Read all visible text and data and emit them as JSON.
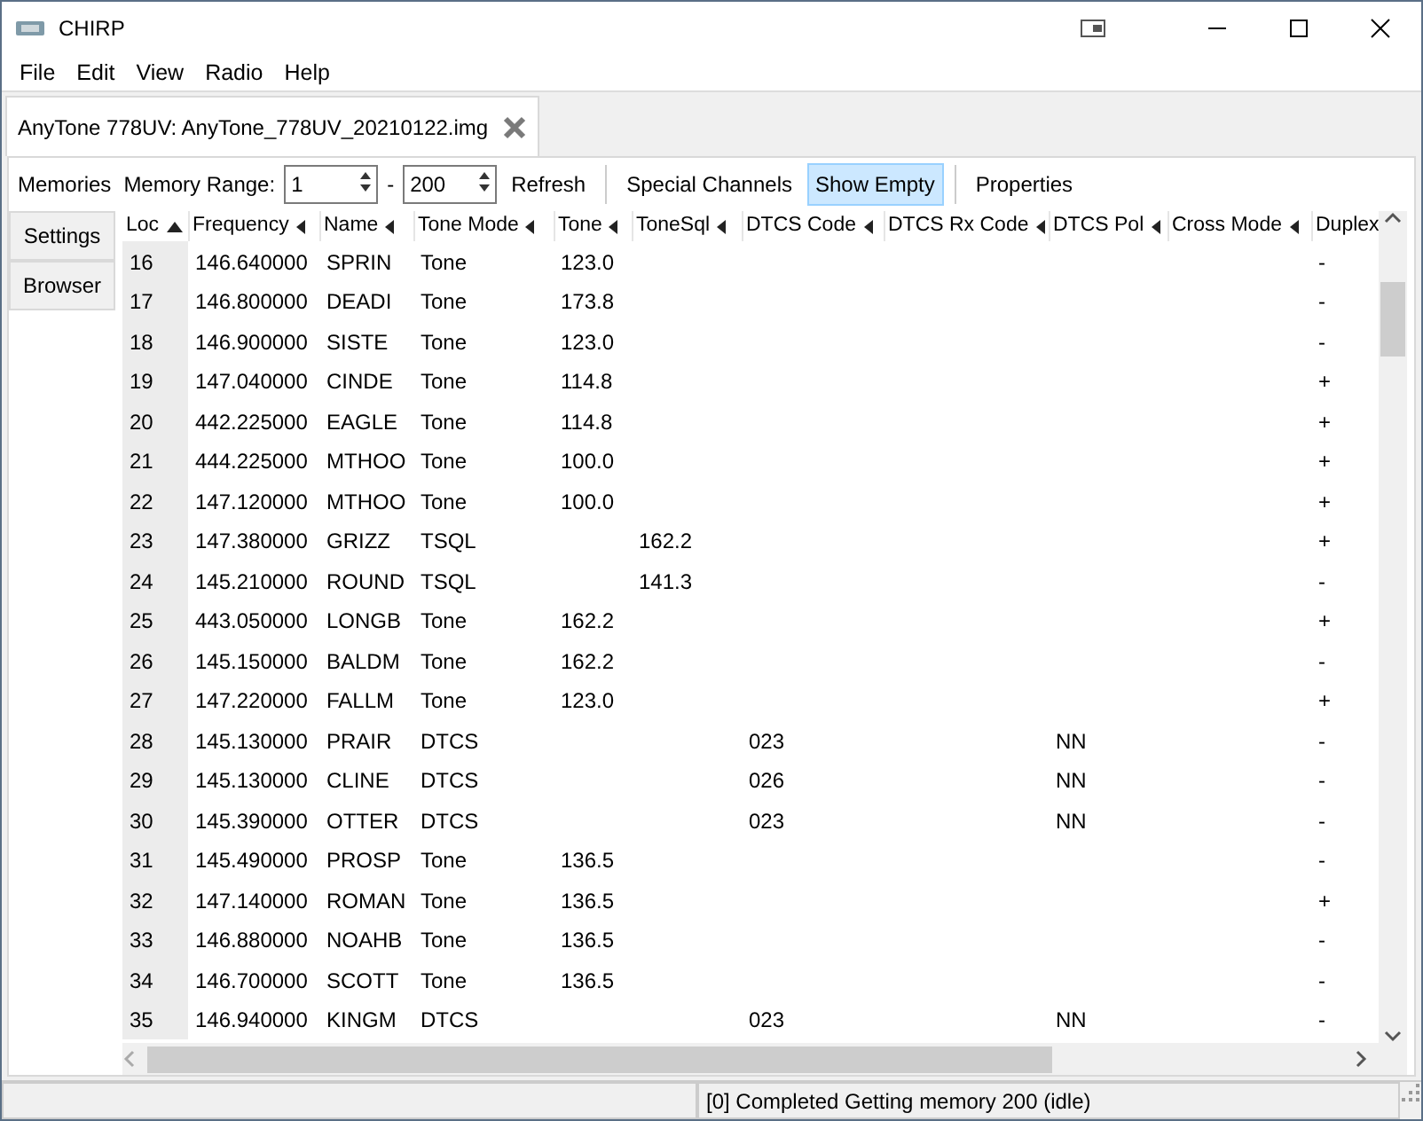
{
  "window": {
    "title": "CHIRP"
  },
  "menu": [
    "File",
    "Edit",
    "View",
    "Radio",
    "Help"
  ],
  "document_tab": {
    "label": "AnyTone 778UV: AnyTone_778UV_20210122.img"
  },
  "side_tabs": [
    {
      "label": "Memories",
      "selected": true
    },
    {
      "label": "Settings",
      "selected": false
    },
    {
      "label": "Browser",
      "selected": false
    }
  ],
  "toolbar": {
    "range_label": "Memory Range:",
    "range_start": "1",
    "separator": "-",
    "range_end": "200",
    "buttons": [
      {
        "label": "Refresh",
        "selected": false
      },
      {
        "label": "Special Channels",
        "selected": false
      },
      {
        "label": "Show Empty",
        "selected": true
      },
      {
        "label": "Properties",
        "selected": false
      }
    ]
  },
  "table": {
    "columns": [
      {
        "label": "Loc",
        "sorted": true
      },
      {
        "label": "Frequency",
        "sorted": false
      },
      {
        "label": "Name",
        "sorted": false
      },
      {
        "label": "Tone Mode",
        "sorted": false
      },
      {
        "label": "Tone",
        "sorted": false
      },
      {
        "label": "ToneSql",
        "sorted": false
      },
      {
        "label": "DTCS Code",
        "sorted": false
      },
      {
        "label": "DTCS Rx Code",
        "sorted": false
      },
      {
        "label": "DTCS Pol",
        "sorted": false
      },
      {
        "label": "Cross Mode",
        "sorted": false
      },
      {
        "label": "Duplex"
      }
    ],
    "rows": [
      [
        "16",
        "146.640000",
        "SPRIN",
        "Tone",
        "123.0",
        "",
        "",
        "",
        "",
        "",
        "-"
      ],
      [
        "17",
        "146.800000",
        "DEADI",
        "Tone",
        "173.8",
        "",
        "",
        "",
        "",
        "",
        "-"
      ],
      [
        "18",
        "146.900000",
        "SISTE",
        "Tone",
        "123.0",
        "",
        "",
        "",
        "",
        "",
        "-"
      ],
      [
        "19",
        "147.040000",
        "CINDE",
        "Tone",
        "114.8",
        "",
        "",
        "",
        "",
        "",
        "+"
      ],
      [
        "20",
        "442.225000",
        "EAGLE",
        "Tone",
        "114.8",
        "",
        "",
        "",
        "",
        "",
        "+"
      ],
      [
        "21",
        "444.225000",
        "MTHOO",
        "Tone",
        "100.0",
        "",
        "",
        "",
        "",
        "",
        "+"
      ],
      [
        "22",
        "147.120000",
        "MTHOO",
        "Tone",
        "100.0",
        "",
        "",
        "",
        "",
        "",
        "+"
      ],
      [
        "23",
        "147.380000",
        "GRIZZ",
        "TSQL",
        "",
        "162.2",
        "",
        "",
        "",
        "",
        "+"
      ],
      [
        "24",
        "145.210000",
        "ROUND",
        "TSQL",
        "",
        "141.3",
        "",
        "",
        "",
        "",
        "-"
      ],
      [
        "25",
        "443.050000",
        "LONGB",
        "Tone",
        "162.2",
        "",
        "",
        "",
        "",
        "",
        "+"
      ],
      [
        "26",
        "145.150000",
        "BALDM",
        "Tone",
        "162.2",
        "",
        "",
        "",
        "",
        "",
        "-"
      ],
      [
        "27",
        "147.220000",
        "FALLM",
        "Tone",
        "123.0",
        "",
        "",
        "",
        "",
        "",
        "+"
      ],
      [
        "28",
        "145.130000",
        "PRAIR",
        "DTCS",
        "",
        "",
        "023",
        "",
        "NN",
        "",
        "-"
      ],
      [
        "29",
        "145.130000",
        "CLINE",
        "DTCS",
        "",
        "",
        "026",
        "",
        "NN",
        "",
        "-"
      ],
      [
        "30",
        "145.390000",
        "OTTER",
        "DTCS",
        "",
        "",
        "023",
        "",
        "NN",
        "",
        "-"
      ],
      [
        "31",
        "145.490000",
        "PROSP",
        "Tone",
        "136.5",
        "",
        "",
        "",
        "",
        "",
        "-"
      ],
      [
        "32",
        "147.140000",
        "ROMAN",
        "Tone",
        "136.5",
        "",
        "",
        "",
        "",
        "",
        "+"
      ],
      [
        "33",
        "146.880000",
        "NOAHB",
        "Tone",
        "136.5",
        "",
        "",
        "",
        "",
        "",
        "-"
      ],
      [
        "34",
        "146.700000",
        "SCOTT",
        "Tone",
        "136.5",
        "",
        "",
        "",
        "",
        "",
        "-"
      ],
      [
        "35",
        "146.940000",
        "KINGM",
        "DTCS",
        "",
        "",
        "023",
        "",
        "NN",
        "",
        "-"
      ]
    ]
  },
  "status_bar": {
    "message": "[0] Completed Getting memory 200 (idle)"
  }
}
